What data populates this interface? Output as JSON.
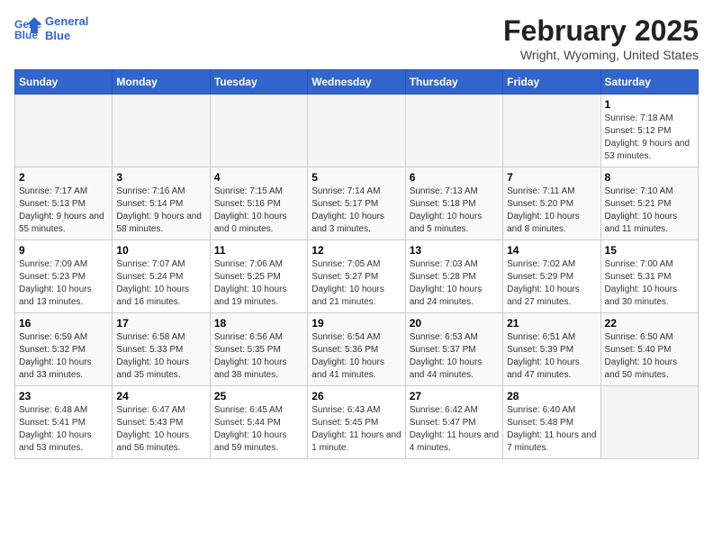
{
  "header": {
    "logo_line1": "General",
    "logo_line2": "Blue",
    "month": "February 2025",
    "location": "Wright, Wyoming, United States"
  },
  "weekdays": [
    "Sunday",
    "Monday",
    "Tuesday",
    "Wednesday",
    "Thursday",
    "Friday",
    "Saturday"
  ],
  "weeks": [
    [
      {
        "day": "",
        "info": ""
      },
      {
        "day": "",
        "info": ""
      },
      {
        "day": "",
        "info": ""
      },
      {
        "day": "",
        "info": ""
      },
      {
        "day": "",
        "info": ""
      },
      {
        "day": "",
        "info": ""
      },
      {
        "day": "1",
        "info": "Sunrise: 7:18 AM\nSunset: 5:12 PM\nDaylight: 9 hours and 53 minutes."
      }
    ],
    [
      {
        "day": "2",
        "info": "Sunrise: 7:17 AM\nSunset: 5:13 PM\nDaylight: 9 hours and 55 minutes."
      },
      {
        "day": "3",
        "info": "Sunrise: 7:16 AM\nSunset: 5:14 PM\nDaylight: 9 hours and 58 minutes."
      },
      {
        "day": "4",
        "info": "Sunrise: 7:15 AM\nSunset: 5:16 PM\nDaylight: 10 hours and 0 minutes."
      },
      {
        "day": "5",
        "info": "Sunrise: 7:14 AM\nSunset: 5:17 PM\nDaylight: 10 hours and 3 minutes."
      },
      {
        "day": "6",
        "info": "Sunrise: 7:13 AM\nSunset: 5:18 PM\nDaylight: 10 hours and 5 minutes."
      },
      {
        "day": "7",
        "info": "Sunrise: 7:11 AM\nSunset: 5:20 PM\nDaylight: 10 hours and 8 minutes."
      },
      {
        "day": "8",
        "info": "Sunrise: 7:10 AM\nSunset: 5:21 PM\nDaylight: 10 hours and 11 minutes."
      }
    ],
    [
      {
        "day": "9",
        "info": "Sunrise: 7:09 AM\nSunset: 5:23 PM\nDaylight: 10 hours and 13 minutes."
      },
      {
        "day": "10",
        "info": "Sunrise: 7:07 AM\nSunset: 5:24 PM\nDaylight: 10 hours and 16 minutes."
      },
      {
        "day": "11",
        "info": "Sunrise: 7:06 AM\nSunset: 5:25 PM\nDaylight: 10 hours and 19 minutes."
      },
      {
        "day": "12",
        "info": "Sunrise: 7:05 AM\nSunset: 5:27 PM\nDaylight: 10 hours and 21 minutes."
      },
      {
        "day": "13",
        "info": "Sunrise: 7:03 AM\nSunset: 5:28 PM\nDaylight: 10 hours and 24 minutes."
      },
      {
        "day": "14",
        "info": "Sunrise: 7:02 AM\nSunset: 5:29 PM\nDaylight: 10 hours and 27 minutes."
      },
      {
        "day": "15",
        "info": "Sunrise: 7:00 AM\nSunset: 5:31 PM\nDaylight: 10 hours and 30 minutes."
      }
    ],
    [
      {
        "day": "16",
        "info": "Sunrise: 6:59 AM\nSunset: 5:32 PM\nDaylight: 10 hours and 33 minutes."
      },
      {
        "day": "17",
        "info": "Sunrise: 6:58 AM\nSunset: 5:33 PM\nDaylight: 10 hours and 35 minutes."
      },
      {
        "day": "18",
        "info": "Sunrise: 6:56 AM\nSunset: 5:35 PM\nDaylight: 10 hours and 38 minutes."
      },
      {
        "day": "19",
        "info": "Sunrise: 6:54 AM\nSunset: 5:36 PM\nDaylight: 10 hours and 41 minutes."
      },
      {
        "day": "20",
        "info": "Sunrise: 6:53 AM\nSunset: 5:37 PM\nDaylight: 10 hours and 44 minutes."
      },
      {
        "day": "21",
        "info": "Sunrise: 6:51 AM\nSunset: 5:39 PM\nDaylight: 10 hours and 47 minutes."
      },
      {
        "day": "22",
        "info": "Sunrise: 6:50 AM\nSunset: 5:40 PM\nDaylight: 10 hours and 50 minutes."
      }
    ],
    [
      {
        "day": "23",
        "info": "Sunrise: 6:48 AM\nSunset: 5:41 PM\nDaylight: 10 hours and 53 minutes."
      },
      {
        "day": "24",
        "info": "Sunrise: 6:47 AM\nSunset: 5:43 PM\nDaylight: 10 hours and 56 minutes."
      },
      {
        "day": "25",
        "info": "Sunrise: 6:45 AM\nSunset: 5:44 PM\nDaylight: 10 hours and 59 minutes."
      },
      {
        "day": "26",
        "info": "Sunrise: 6:43 AM\nSunset: 5:45 PM\nDaylight: 11 hours and 1 minute."
      },
      {
        "day": "27",
        "info": "Sunrise: 6:42 AM\nSunset: 5:47 PM\nDaylight: 11 hours and 4 minutes."
      },
      {
        "day": "28",
        "info": "Sunrise: 6:40 AM\nSunset: 5:48 PM\nDaylight: 11 hours and 7 minutes."
      },
      {
        "day": "",
        "info": ""
      }
    ]
  ]
}
